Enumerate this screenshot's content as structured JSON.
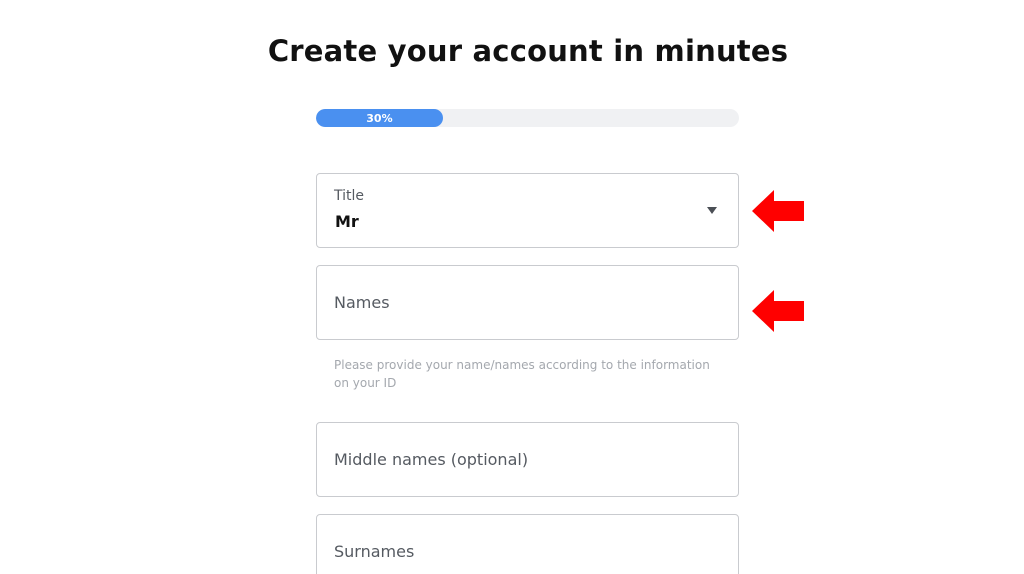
{
  "page": {
    "title": "Create your account in minutes"
  },
  "progress": {
    "label": "30%",
    "value": 0.3,
    "fill_color": "#4a90f0",
    "track_color": "#f0f1f3"
  },
  "form": {
    "title_field": {
      "label": "Title",
      "value": "Mr",
      "icon": "caret-down-icon"
    },
    "names_field": {
      "placeholder": "Names",
      "helper": "Please provide your name/names according to the information on your ID"
    },
    "middle_names_field": {
      "placeholder": "Middle names (optional)"
    },
    "surnames_field": {
      "placeholder": "Surnames"
    }
  },
  "annotations": {
    "arrow_icon": "red-arrow-left-icon",
    "arrow_color": "#ff0000"
  }
}
